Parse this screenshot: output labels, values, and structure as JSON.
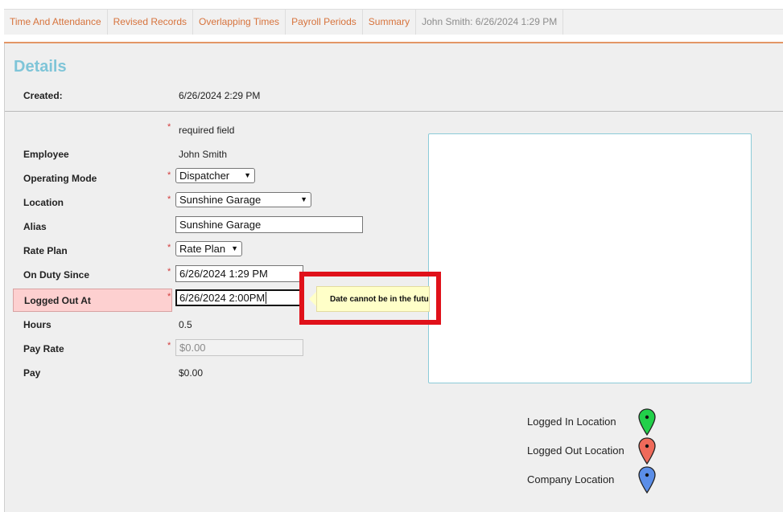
{
  "tabs": [
    {
      "label": "Time And Attendance"
    },
    {
      "label": "Revised Records"
    },
    {
      "label": "Overlapping Times"
    },
    {
      "label": "Payroll Periods"
    },
    {
      "label": "Summary"
    },
    {
      "label": "John Smith: 6/26/2024 1:29 PM"
    }
  ],
  "details": {
    "title": "Details",
    "created_label": "Created:",
    "created_value": "6/26/2024 2:29 PM",
    "required_mark": "*",
    "required_text": "required field"
  },
  "form": {
    "employee": {
      "label": "Employee",
      "value": "John Smith"
    },
    "operating_mode": {
      "label": "Operating Mode",
      "value": "Dispatcher"
    },
    "location": {
      "label": "Location",
      "value": "Sunshine Garage"
    },
    "alias": {
      "label": "Alias",
      "value": "Sunshine Garage"
    },
    "rate_plan": {
      "label": "Rate Plan",
      "value": "Rate Plan"
    },
    "on_duty_since": {
      "label": "On Duty Since",
      "value": "6/26/2024 1:29 PM"
    },
    "logged_out_at": {
      "label": "Logged Out At",
      "value": "6/26/2024 2:00PM"
    },
    "hours": {
      "label": "Hours",
      "value": "0.5"
    },
    "pay_rate": {
      "label": "Pay Rate",
      "placeholder": "$0.00"
    },
    "pay": {
      "label": "Pay",
      "value": "$0.00"
    }
  },
  "tooltip": {
    "text": "Date cannot be in the futu"
  },
  "legend": [
    {
      "label": "Logged In Location",
      "icon": "green-map-pin-icon",
      "color": "#22d04a"
    },
    {
      "label": "Logged Out Location",
      "icon": "red-map-pin-icon",
      "color": "#ef6a5a"
    },
    {
      "label": "Company Location",
      "icon": "blue-map-pin-icon",
      "color": "#5b8ee8"
    }
  ],
  "colors": {
    "accent": "#d7733c",
    "title": "#7fc5d8",
    "error_bg": "#fdd0d0",
    "highlight": "#e0111a"
  }
}
